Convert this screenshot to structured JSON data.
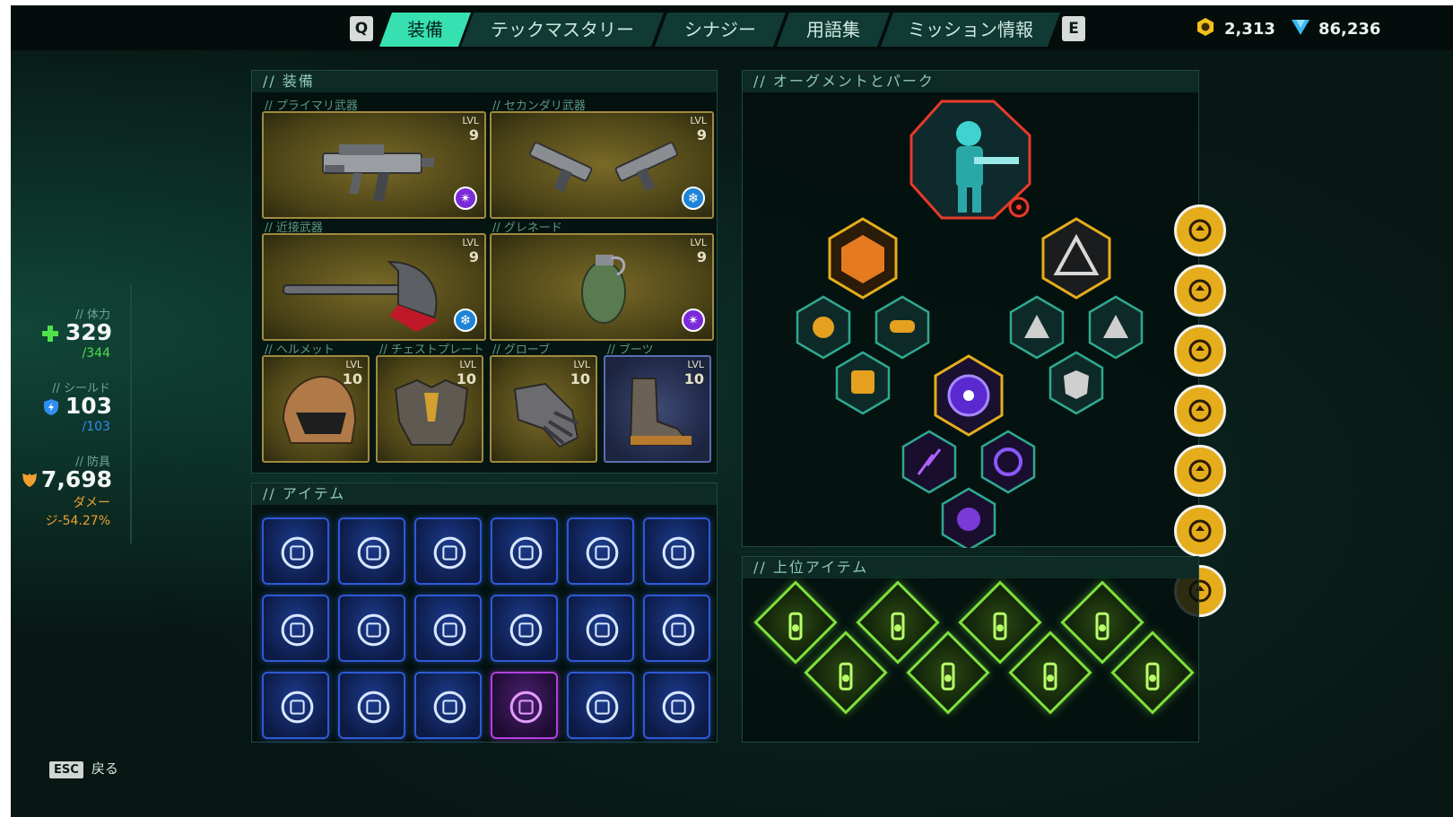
{
  "nav": {
    "left_key": "Q",
    "right_key": "E",
    "tabs": [
      "装備",
      "テックマスタリー",
      "シナジー",
      "用語集",
      "ミッション情報"
    ],
    "active_tab": 0
  },
  "currency": {
    "coins": "2,313",
    "crystals": "86,236"
  },
  "stats": {
    "health_label": "// 体力",
    "health": "329",
    "health_max": "/344",
    "shield_label": "// シールド",
    "shield": "103",
    "shield_max": "/103",
    "armor_label": "// 防具",
    "armor": "7,698",
    "armor_note_1": "ダメー",
    "armor_note_2": "ジ-54.27%"
  },
  "equipment": {
    "title": "// 装備",
    "lvl_text": "LVL",
    "slots": [
      {
        "label": "// プライマリ武器",
        "level": "9",
        "icon": "smg-icon",
        "badge": "void-badge-icon"
      },
      {
        "label": "// セカンダリ武器",
        "level": "9",
        "icon": "dual-pistols-icon",
        "badge": "frost-badge-icon"
      },
      {
        "label": "// 近接武器",
        "level": "9",
        "icon": "axe-icon",
        "badge": "frost-badge-icon"
      },
      {
        "label": "// グレネード",
        "level": "9",
        "icon": "grenade-icon",
        "badge": "void-badge-icon"
      },
      {
        "label": "// ヘルメット",
        "level": "10",
        "icon": "helmet-icon"
      },
      {
        "label": "// チェストプレート",
        "level": "10",
        "icon": "chestplate-icon"
      },
      {
        "label": "// グローブ",
        "level": "10",
        "icon": "gloves-icon"
      },
      {
        "label": "// ブーツ",
        "level": "10",
        "icon": "boots-icon"
      }
    ]
  },
  "items": {
    "title": "// アイテム",
    "icons": [
      "goggles-icon",
      "ticket-icon",
      "wand-icon",
      "keycard-icon",
      "biohazard-crate-icon",
      "gear-phone-icon",
      "grenade-icon",
      "spray-icon",
      "brass-knuckles-icon",
      "eye-orb-icon",
      "yin-yang-icon",
      "camera-tripod-icon",
      "coffee-cup-icon",
      "magazine-icon",
      "bottle-icon",
      "purple-grenade-icon",
      "jar-icon",
      "arm-armor-icon"
    ]
  },
  "augments": {
    "title": "// オーグメントとパーク",
    "hero_icon": "soldier-portrait-icon"
  },
  "sidebar_perks": [
    "canister-icon",
    "ammo-icon",
    "power-fist-icon",
    "tally-icon",
    "question-coin-icon",
    "arrows-up-icon",
    "fist-icon"
  ],
  "top_items": {
    "title": "// 上位アイテム",
    "icons": [
      "flask-icon",
      "pistol-icon",
      "scroll-icon",
      "water-bottle-icon",
      "rifle-icon",
      "iv-bag-icon",
      "rocket-icon",
      "pill-jar-icon"
    ]
  },
  "footer": {
    "key": "ESC",
    "label": "戻る"
  },
  "colors": {
    "accent": "#36e0b0",
    "gold": "#e5ad1c",
    "item_blue": "#2e59d6",
    "top_item_green": "#7ee03c"
  }
}
